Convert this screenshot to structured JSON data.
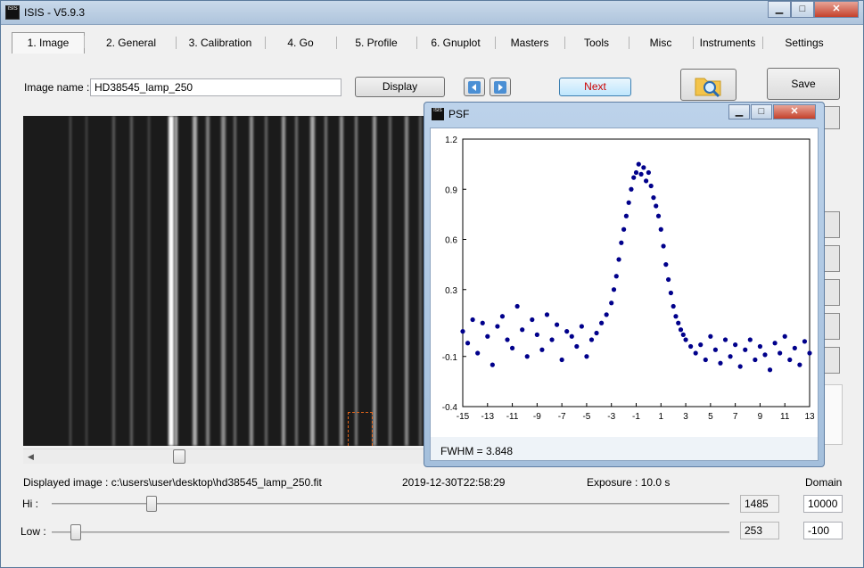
{
  "window": {
    "title": "ISIS - V5.9.3",
    "icon_text": "ISIS"
  },
  "tabs": [
    "1. Image",
    "2. General",
    "3. Calibration",
    "4. Go",
    "5. Profile",
    "6. Gnuplot",
    "Masters",
    "Tools",
    "Misc",
    "Instruments",
    "Settings"
  ],
  "image_name": {
    "label": "Image name :",
    "value": "HD38545_lamp_250"
  },
  "buttons": {
    "display": "Display",
    "next": "Next",
    "save": "Save"
  },
  "status": {
    "displayed_image": "Displayed image : c:\\users\\user\\desktop\\hd38545_lamp_250.fit",
    "timestamp": "2019-12-30T22:58:29",
    "exposure": "Exposure : 10.0 s",
    "domain_label": "Domain"
  },
  "levels": {
    "hi_label": "Hi :",
    "hi_value": "1485",
    "hi_domain": "10000",
    "hi_fraction": 0.148,
    "low_label": "Low :",
    "low_value": "253",
    "low_domain": "-100",
    "low_fraction": 0.035
  },
  "psf_window": {
    "title": "PSF",
    "fwhm": "FWHM = 3.848"
  },
  "colors": {
    "accent": "#cc0000",
    "points": "#00008b"
  },
  "chart_data": {
    "type": "scatter",
    "xlim": [
      -15,
      13
    ],
    "ylim": [
      -0.4,
      1.2
    ],
    "xticks": [
      "-15",
      "-13",
      "-11",
      "-9",
      "-7",
      "-5",
      "-3",
      "-1",
      "1",
      "3",
      "5",
      "7",
      "9",
      "11",
      "13"
    ],
    "yticks": [
      "1.2",
      "0.9",
      "0.6",
      "0.3",
      "-0.1",
      "-0.4"
    ],
    "grid": false,
    "series": [
      {
        "x": [
          -15.0,
          -14.6,
          -14.2,
          -13.8,
          -13.4,
          -13.0,
          -12.6,
          -12.2,
          -11.8,
          -11.4,
          -11.0,
          -10.6,
          -10.2,
          -9.8,
          -9.4,
          -9.0,
          -8.6,
          -8.2,
          -7.8,
          -7.4,
          -7.0,
          -6.6,
          -6.2,
          -5.8,
          -5.4,
          -5.0,
          -4.6,
          -4.2,
          -3.8,
          -3.4,
          -3.0,
          -2.8,
          -2.6,
          -2.4,
          -2.2,
          -2.0,
          -1.8,
          -1.6,
          -1.4,
          -1.2,
          -1.0,
          -0.8,
          -0.6,
          -0.4,
          -0.2,
          0.0,
          0.2,
          0.4,
          0.6,
          0.8,
          1.0,
          1.2,
          1.4,
          1.6,
          1.8,
          2.0,
          2.2,
          2.4,
          2.6,
          2.8,
          3.0,
          3.4,
          3.8,
          4.2,
          4.6,
          5.0,
          5.4,
          5.8,
          6.2,
          6.6,
          7.0,
          7.4,
          7.8,
          8.2,
          8.6,
          9.0,
          9.4,
          9.8,
          10.2,
          10.6,
          11.0,
          11.4,
          11.8,
          12.2,
          12.6,
          13.0
        ],
        "y": [
          0.05,
          -0.02,
          0.12,
          -0.08,
          0.1,
          0.02,
          -0.15,
          0.08,
          0.14,
          0.0,
          -0.05,
          0.2,
          0.06,
          -0.1,
          0.12,
          0.03,
          -0.06,
          0.15,
          0.0,
          0.09,
          -0.12,
          0.05,
          0.02,
          -0.04,
          0.08,
          -0.1,
          0.0,
          0.04,
          0.1,
          0.15,
          0.22,
          0.3,
          0.38,
          0.48,
          0.58,
          0.66,
          0.74,
          0.82,
          0.9,
          0.97,
          1.0,
          1.05,
          0.99,
          1.03,
          0.95,
          1.0,
          0.92,
          0.85,
          0.8,
          0.74,
          0.66,
          0.56,
          0.45,
          0.36,
          0.28,
          0.2,
          0.14,
          0.1,
          0.06,
          0.03,
          0.0,
          -0.04,
          -0.08,
          -0.03,
          -0.12,
          0.02,
          -0.06,
          -0.14,
          0.0,
          -0.1,
          -0.03,
          -0.16,
          -0.06,
          0.0,
          -0.12,
          -0.04,
          -0.09,
          -0.18,
          -0.02,
          -0.08,
          0.02,
          -0.12,
          -0.05,
          -0.15,
          -0.01,
          -0.08
        ]
      }
    ]
  }
}
